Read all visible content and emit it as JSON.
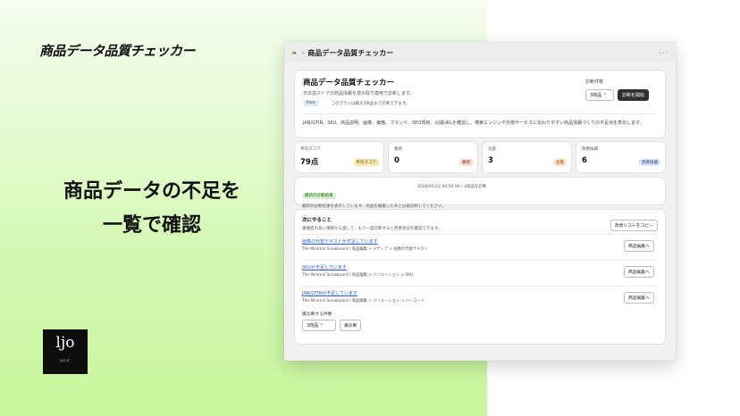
{
  "hero": {
    "title": "商品データ品質チェッカー",
    "subtitle_line1": "商品データの不足を",
    "subtitle_line2": "一覧で確認"
  },
  "logo": {
    "mark": "ljo",
    "small": "LLC"
  },
  "window": {
    "header_title": "商品データ品質チェッカー",
    "menu": "···"
  },
  "top_card": {
    "title": "商品データ品質チェッカー",
    "description": "日本語ストアの商品情報を読み取り専用で診断します。",
    "free_badge": "Free",
    "free_note": "このプランは最大3商品まで診断できます。",
    "count_label": "診断件数",
    "count_value": "3商品 ⌃",
    "run_button": "診断を開始",
    "note": "JAN/GTIN、SKU、商品説明、画像、価格、ブランド、SEO項目、公開URLを確認し、検索エンジンや外部サービスに伝わりやすい商品情報づくりの不足点を表示します。"
  },
  "stats": [
    {
      "label": "平均スコア",
      "value": "79点",
      "badge": "平均スコア"
    },
    {
      "label": "要修",
      "value": "0",
      "badge": "要修"
    },
    {
      "label": "注意",
      "value": "3",
      "badge": "注意"
    },
    {
      "label": "改善候補",
      "value": "6",
      "badge": "改善候補"
    }
  ],
  "last_result": {
    "badge": "最新の診断結果",
    "time": "2026/05/22 00:50:09 / 3商品を診断",
    "desc": "最新の診断結果を表示しています。商品を編集したあとは再診断してください。"
  },
  "todo": {
    "title": "次にやること",
    "desc": "重要度の高い項目から直して、もう一度診断すると改善状況を確認できます。",
    "copy_button": "改善リストをコピー",
    "items": [
      {
        "title": "画像の代替テキストが不足しています",
        "path": "The Minimal Snowboard / 商品編集 > メディア > 画像の代替テキスト",
        "button": "商品編集へ"
      },
      {
        "title": "SKUが不足しています",
        "path": "The Minimal Snowboard / 商品編集 > バリエーション > SKU",
        "button": "商品編集へ"
      },
      {
        "title": "JAN/GTINが不足しています",
        "path": "The Minimal Snowboard / 商品編集 > バリエーション > バーコード",
        "button": "商品編集へ"
      }
    ],
    "rediag_label": "再診断する件数",
    "rediag_value": "3商品 ⌃",
    "rediag_button": "再診断"
  }
}
